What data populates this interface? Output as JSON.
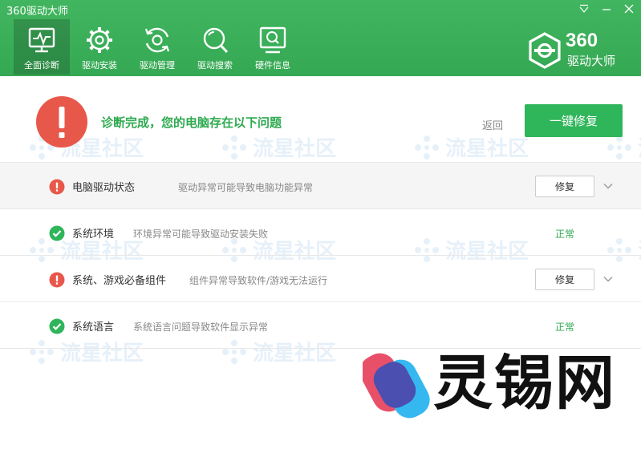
{
  "window": {
    "title": "360驱动大师"
  },
  "nav": {
    "tabs": [
      {
        "label": "全面诊断",
        "icon": "monitor-pulse-icon",
        "active": true
      },
      {
        "label": "驱动安装",
        "icon": "gear-icon",
        "active": false
      },
      {
        "label": "驱动管理",
        "icon": "refresh-gear-icon",
        "active": false
      },
      {
        "label": "驱动搜索",
        "icon": "search-icon",
        "active": false
      },
      {
        "label": "硬件信息",
        "icon": "hardware-search-icon",
        "active": false
      }
    ]
  },
  "logo": {
    "number": "360",
    "subtitle": "驱动大师"
  },
  "status": {
    "message": "诊断完成，您的电脑存在以下问题",
    "back_label": "返回",
    "fix_all_label": "一键修复"
  },
  "items": [
    {
      "title": "电脑驱动状态",
      "desc": "驱动异常可能导致电脑功能异常",
      "state": "error",
      "action": "修复"
    },
    {
      "title": "系统环境",
      "desc": "环境异常可能导致驱动安装失败",
      "state": "ok",
      "action": "正常"
    },
    {
      "title": "系统、游戏必备组件",
      "desc": "组件异常导致软件/游戏无法运行",
      "state": "error",
      "action": "修复"
    },
    {
      "title": "系统语言",
      "desc": "系统语言问题导致软件显示异常",
      "state": "ok",
      "action": "正常"
    }
  ],
  "watermark": {
    "text": "流星社区"
  },
  "brand": {
    "text": "灵锡网"
  },
  "colors": {
    "header_green": "#3ab058",
    "accent_green": "#2fb55a",
    "error_red": "#e8584a",
    "ok_green": "#2faa50"
  }
}
